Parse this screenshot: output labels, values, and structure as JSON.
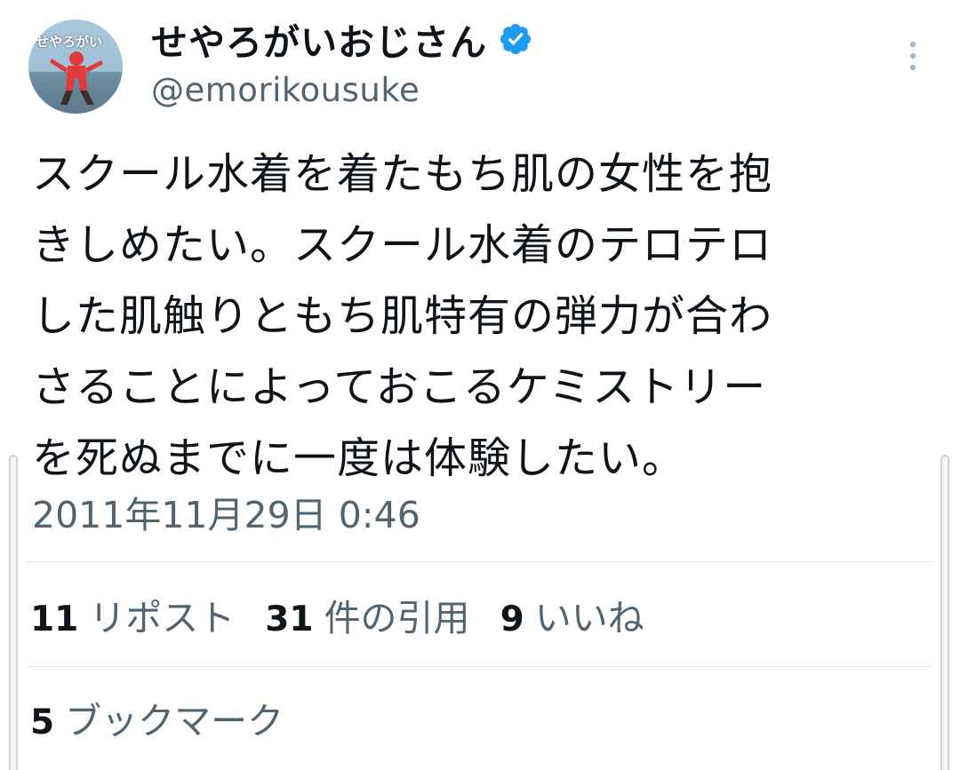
{
  "author": {
    "display_name": "せやろがいおじさん",
    "handle": "@emorikousuke",
    "verified": true,
    "avatar_text": "せやろがい"
  },
  "tweet": {
    "text_lines": [
      "スクール水着を着たもち肌の女性を抱",
      "きしめたい。スクール水着のテロテロ",
      "した肌触りともち肌特有の弾力が合わ",
      "さることによっておこるケミストリー",
      "を死ぬまでに一度は体験したい。"
    ],
    "timestamp": "2011年11月29日 0:46"
  },
  "stats": {
    "reposts": {
      "count": "11",
      "label": "リポスト"
    },
    "quotes": {
      "count": "31",
      "label": "件の引用"
    },
    "likes": {
      "count": "9",
      "label": "いいね"
    },
    "bookmarks": {
      "count": "5",
      "label": "ブックマーク"
    }
  },
  "icons": {
    "verified": "verified-badge-icon",
    "more": "more-vertical-icon"
  },
  "colors": {
    "text_primary": "#0f1419",
    "text_secondary": "#536471",
    "verified_blue": "#1d9bf0",
    "divider": "#e1e6ea"
  }
}
